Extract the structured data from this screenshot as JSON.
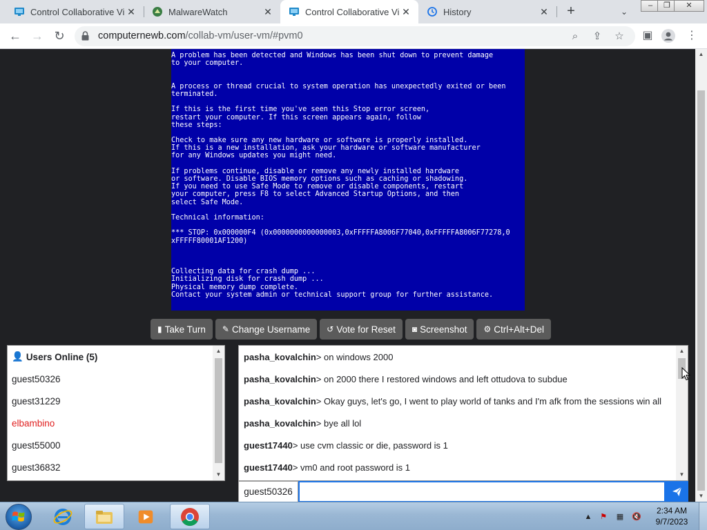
{
  "browser": {
    "tabs": [
      {
        "title": "Control Collaborative Virt",
        "icon": "monitor-icon",
        "active": false
      },
      {
        "title": "MalwareWatch",
        "icon": "malwarewatch-icon",
        "active": false
      },
      {
        "title": "Control Collaborative Virt",
        "icon": "monitor-icon",
        "active": true
      },
      {
        "title": "History",
        "icon": "history-icon",
        "active": false
      }
    ],
    "close_glyph": "✕",
    "new_tab_glyph": "+",
    "url_host": "computernewb.com",
    "url_path": "/collab-vm/user-vm/#pvm0"
  },
  "bsod_lines": [
    "A problem has been detected and Windows has been shut down to prevent damage",
    "to your computer.",
    "",
    "",
    "A process or thread crucial to system operation has unexpectedly exited or been",
    "terminated.",
    "",
    "If this is the first time you've seen this Stop error screen,",
    "restart your computer. If this screen appears again, follow",
    "these steps:",
    "",
    "Check to make sure any new hardware or software is properly installed.",
    "If this is a new installation, ask your hardware or software manufacturer",
    "for any Windows updates you might need.",
    "",
    "If problems continue, disable or remove any newly installed hardware",
    "or software. Disable BIOS memory options such as caching or shadowing.",
    "If you need to use Safe Mode to remove or disable components, restart",
    "your computer, press F8 to select Advanced Startup Options, and then",
    "select Safe Mode.",
    "",
    "Technical information:",
    "",
    "*** STOP: 0x000000F4 (0x0000000000000003,0xFFFFFA8006F77040,0xFFFFFA8006F77278,0",
    "xFFFFF80001AF1200)",
    "",
    "",
    "",
    "Collecting data for crash dump ...",
    "Initializing disk for crash dump ...",
    "Physical memory dump complete.",
    "Contact your system admin or technical support group for further assistance."
  ],
  "actions": {
    "take_turn": "Take Turn",
    "change_username": "Change Username",
    "vote_reset": "Vote for Reset",
    "screenshot": "Screenshot",
    "ctrl_alt_del": "Ctrl+Alt+Del"
  },
  "users": {
    "header": "Users Online (5)",
    "list": [
      {
        "name": "guest50326",
        "color": "#202124"
      },
      {
        "name": "guest31229",
        "color": "#202124"
      },
      {
        "name": "elbambino",
        "color": "#e02020"
      },
      {
        "name": "guest55000",
        "color": "#202124"
      },
      {
        "name": "guest36832",
        "color": "#202124"
      }
    ]
  },
  "chat": [
    {
      "user": "pasha_kovalchin",
      "msg": "on windows 2000"
    },
    {
      "user": "pasha_kovalchin",
      "msg": "on 2000 there I restored windows and left ottudova to subdue"
    },
    {
      "user": "pasha_kovalchin",
      "msg": "Okay guys, let's go, I went to play world of tanks and I'm afk from the sessions win all"
    },
    {
      "user": "pasha_kovalchin",
      "msg": "bye all lol"
    },
    {
      "user": "guest17440",
      "msg": "use cvm classic or die, password is 1"
    },
    {
      "user": "guest17440",
      "msg": "vm0 and root password is 1"
    }
  ],
  "chat_separator": "> ",
  "input": {
    "nickname": "guest50326",
    "value": ""
  },
  "taskbar": {
    "time": "2:34 AM",
    "date": "9/7/2023"
  },
  "colors": {
    "bsod_blue": "#0000a8",
    "page_bg": "#202124",
    "accent": "#1a73e8",
    "button_gray": "#5b5b5b",
    "moderator_red": "#e02020"
  }
}
